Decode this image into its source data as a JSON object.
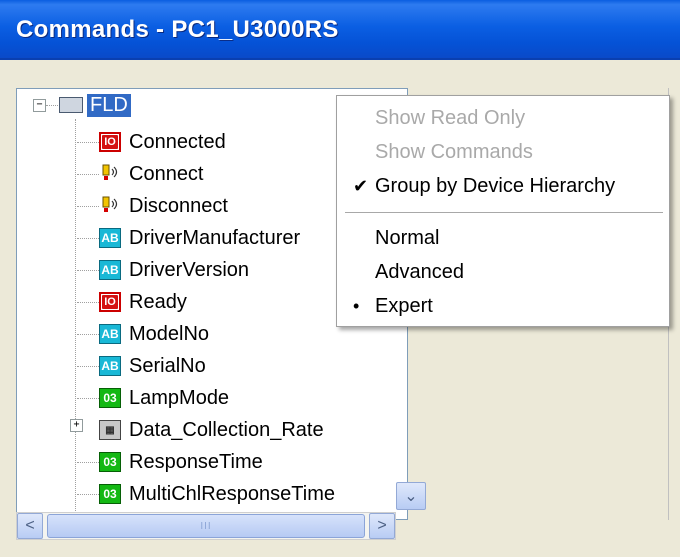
{
  "window": {
    "title": "Commands - PC1_U3000RS"
  },
  "tree": {
    "root": {
      "label": "FLD",
      "icon": "device-icon",
      "expanded": true
    },
    "children": [
      {
        "label": "Connected",
        "icon": "io-icon",
        "icon_text": "IO"
      },
      {
        "label": "Connect",
        "icon": "command-bulb-icon",
        "icon_text": "💡"
      },
      {
        "label": "Disconnect",
        "icon": "command-bulb-icon",
        "icon_text": "💡"
      },
      {
        "label": "DriverManufacturer",
        "icon": "text-property-icon",
        "icon_text": "AB"
      },
      {
        "label": "DriverVersion",
        "icon": "text-property-icon",
        "icon_text": "AB"
      },
      {
        "label": "Ready",
        "icon": "io-icon",
        "icon_text": "IO"
      },
      {
        "label": "ModelNo",
        "icon": "text-property-icon",
        "icon_text": "AB"
      },
      {
        "label": "SerialNo",
        "icon": "text-property-icon",
        "icon_text": "AB"
      },
      {
        "label": "LampMode",
        "icon": "numeric-property-icon",
        "icon_text": "03"
      },
      {
        "label": "Data_Collection_Rate",
        "icon": "grid-property-icon",
        "icon_text": "▦"
      },
      {
        "label": "ResponseTime",
        "icon": "numeric-property-icon",
        "icon_text": "03"
      },
      {
        "label": "MultiChlResponseTime",
        "icon": "numeric-property-icon",
        "icon_text": "03"
      }
    ]
  },
  "context_menu": {
    "items": [
      {
        "label": "Show Read Only",
        "disabled": true,
        "mark": ""
      },
      {
        "label": "Show Commands",
        "disabled": true,
        "mark": ""
      },
      {
        "label": "Group by Device Hierarchy",
        "disabled": false,
        "mark": "✔"
      },
      {
        "label": "Normal",
        "disabled": false,
        "mark": ""
      },
      {
        "label": "Advanced",
        "disabled": false,
        "mark": ""
      },
      {
        "label": "Expert",
        "disabled": false,
        "mark": "•"
      }
    ]
  },
  "scrollbar": {
    "left_arrow": "<",
    "right_arrow": ">",
    "down_arrow": "⌄",
    "grip": "III"
  },
  "colors": {
    "titlebar": "#0552d6",
    "selection": "#316ac5",
    "disabled_text": "#a9a9a9"
  }
}
